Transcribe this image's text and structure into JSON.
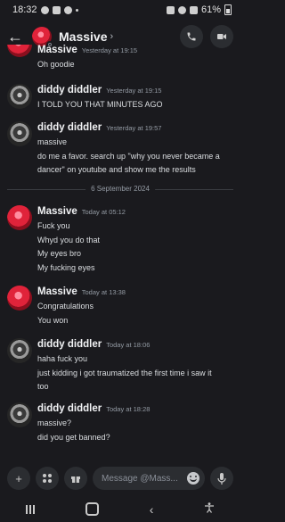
{
  "status_bar": {
    "time": "18:32",
    "battery": "61%"
  },
  "header": {
    "back_icon": "arrow-left-icon",
    "title": "Massive",
    "chevron": "›"
  },
  "messages": [
    {
      "author": "Massive",
      "timestamp": "Yesterday at 19:15",
      "lines": [
        "Oh goodie"
      ]
    },
    {
      "author": "diddy diddler",
      "timestamp": "Yesterday at 19:15",
      "lines": [
        "I TOLD YOU THAT MINUTES AGO"
      ]
    },
    {
      "author": "diddy diddler",
      "timestamp": "Yesterday at 19:57",
      "lines": [
        "massive",
        "do me a favor. search up \"why you never became a",
        "dancer\" on youtube and show me the results"
      ]
    },
    {
      "author": "Massive",
      "timestamp": "Today at 05:12",
      "lines": [
        "Fuck you",
        "Whyd you do that",
        "My eyes bro",
        "My fucking eyes"
      ]
    },
    {
      "author": "Massive",
      "timestamp": "Today at 13:38",
      "lines": [
        "Congratulations",
        "You won"
      ]
    },
    {
      "author": "diddy diddler",
      "timestamp": "Today at 18:06",
      "lines": [
        "haha fuck you",
        "just kidding i got traumatized the first time i saw it",
        "too"
      ]
    },
    {
      "author": "diddy diddler",
      "timestamp": "Today at 18:28",
      "lines": [
        "massive?",
        "did you get banned?"
      ]
    }
  ],
  "divider": {
    "label": "6 September 2024"
  },
  "composer": {
    "placeholder": "Message @Mass..."
  },
  "colors": {
    "background": "#1a1a1e",
    "surface": "#2b2d31",
    "timestamp": "#949ba4"
  }
}
